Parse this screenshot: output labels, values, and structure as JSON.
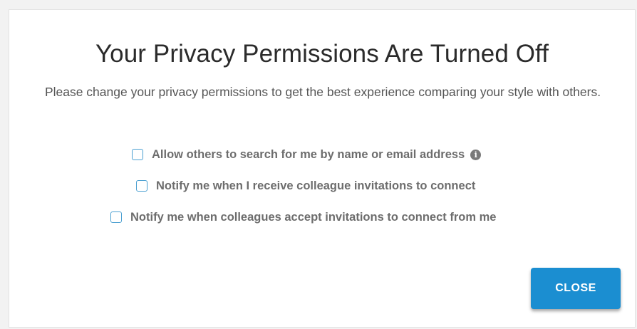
{
  "modal": {
    "title": "Your Privacy Permissions Are Turned Off",
    "description": "Please change your privacy permissions to get the best experience comparing your style with others.",
    "options": [
      {
        "label": "Allow others to search for me by name or email address",
        "checked": false,
        "has_info_icon": true
      },
      {
        "label": "Notify me when I receive colleague invitations to connect",
        "checked": false
      },
      {
        "label": "Notify me when colleagues accept invitations to connect from me",
        "checked": false
      }
    ],
    "info_icon_glyph": "i",
    "close_label": "CLOSE"
  },
  "colors": {
    "accent": "#1b8ed1",
    "checkbox_border": "#4a9fd1",
    "title_text": "#2b2b2b",
    "option_text": "#6d6d6d"
  },
  "icons": [
    "info-icon"
  ]
}
